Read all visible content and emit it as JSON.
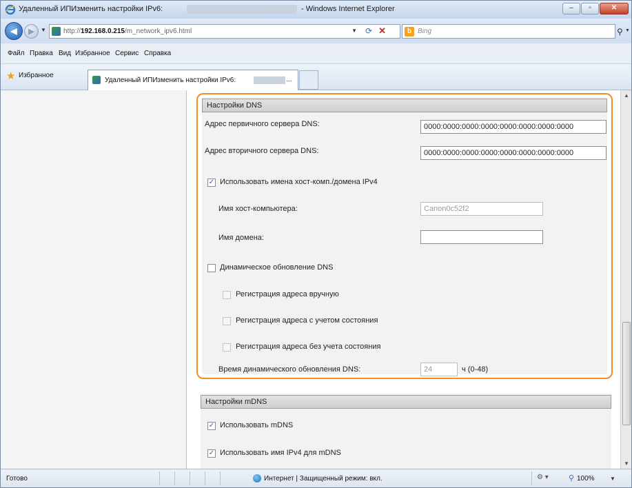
{
  "window": {
    "title": "Удаленный ИПИзменить настройки IPv6:",
    "title_suffix": "- Windows Internet Explorer",
    "min_glyph": "–",
    "max_glyph": "▫",
    "close_glyph": "✕"
  },
  "address_bar": {
    "url_prefix": "http://",
    "url_host": "192.168.0.215",
    "url_path": "/m_network_ipv6.html",
    "search_placeholder": "Bing",
    "bing_glyph": "b"
  },
  "menu": [
    "Файл",
    "Правка",
    "Вид",
    "Избранное",
    "Сервис",
    "Справка"
  ],
  "favorites": {
    "label": "Избранное",
    "tab_title": "Удаленный ИПИзменить настройки IPv6:",
    "tab_ellipsis": "..."
  },
  "dns": {
    "header": "Настройки DNS",
    "primary_label": "Адрес первичного сервера DNS:",
    "primary_value": "0000:0000:0000:0000:0000:0000:0000:0000",
    "secondary_label": "Адрес вторичного сервера DNS:",
    "secondary_value": "0000:0000:0000:0000:0000:0000:0000:0000",
    "use_ipv4_label": "Использовать имена хост-комп./домена IPv4",
    "use_ipv4_checked": true,
    "host_label": "Имя хост-компьютера:",
    "host_value": "Canon0c52f2",
    "domain_label": "Имя домена:",
    "domain_value": "",
    "dyn_update_label": "Динамическое обновление DNS",
    "dyn_update_checked": false,
    "manual_reg_label": "Регистрация адреса вручную",
    "stateful_reg_label": "Регистрация адреса с учетом состояния",
    "stateless_reg_label": "Регистрация адреса без учета состояния",
    "interval_label": "Время динамического обновления DNS:",
    "interval_value": "24",
    "interval_unit": "ч (0-48)"
  },
  "mdns": {
    "header": "Настройки mDNS",
    "use_mdns_label": "Использовать mDNS",
    "use_ipv4_name_label": "Использовать имя IPv4 для mDNS"
  },
  "checkmark": "✓",
  "status": {
    "text": "Готово",
    "zone": "Интернет | Защищенный режим: вкл.",
    "zoom": "100%"
  }
}
